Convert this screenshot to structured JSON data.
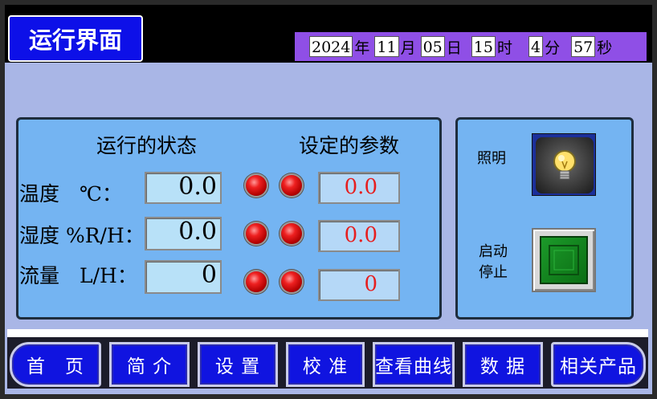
{
  "header": {
    "title": "运行界面",
    "datetime": {
      "year": "2024",
      "year_unit": "年",
      "month": "11",
      "month_unit": "月",
      "day": "05",
      "day_unit": "日",
      "hour": "15",
      "hour_unit": "时",
      "minute": "4",
      "minute_unit": "分",
      "second": "57",
      "second_unit": "秒"
    }
  },
  "main_panel": {
    "running_status_heading": "运行的状态",
    "set_params_heading": "设定的参数",
    "rows": [
      {
        "label": "温度　℃：",
        "current": "0.0",
        "setpoint": "0.0"
      },
      {
        "label": "湿度 %R/H：",
        "current": "0.0",
        "setpoint": "0.0"
      },
      {
        "label": "流量　L/H：",
        "current": "0",
        "setpoint": "0"
      }
    ]
  },
  "side_panel": {
    "lighting_label": "照明",
    "start_label": "启动",
    "stop_label": "停止",
    "lamp_icon": "lightbulb-icon",
    "start_button_icon": "square-button-icon"
  },
  "nav": {
    "home": "首　页",
    "intro": "简 介",
    "settings": "设 置",
    "calibrate": "校 准",
    "curves": "查看曲线",
    "data": "数 据",
    "products": "相关产品"
  },
  "colors": {
    "title_bg": "#0d10e8",
    "datetime_bg": "#8f4fe6",
    "panel_bg": "#74b4f2",
    "screen_bg": "#a9b6e6",
    "setpoint_text": "#e61f1f",
    "led": "#ee2020",
    "start_button": "#1c9a2a"
  }
}
